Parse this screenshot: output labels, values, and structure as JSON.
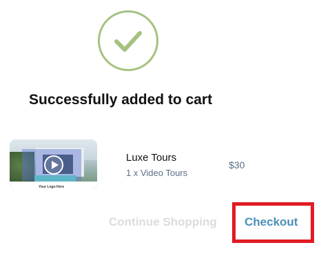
{
  "confirmation": {
    "icon": "check-circle-icon",
    "icon_color": "#a6c17f",
    "title": "Successfully added to cart"
  },
  "cart_item": {
    "thumbnail_logo_text": "Your Logo Here",
    "thumbnail_icon": "play-icon",
    "name": "Luxe Tours",
    "quantity_text": "1 x Video Tours",
    "price": "$30"
  },
  "actions": {
    "continue_label": "Continue Shopping",
    "checkout_label": "Checkout",
    "checkout_color": "#4a90b8",
    "highlight_color": "#e01b24"
  }
}
